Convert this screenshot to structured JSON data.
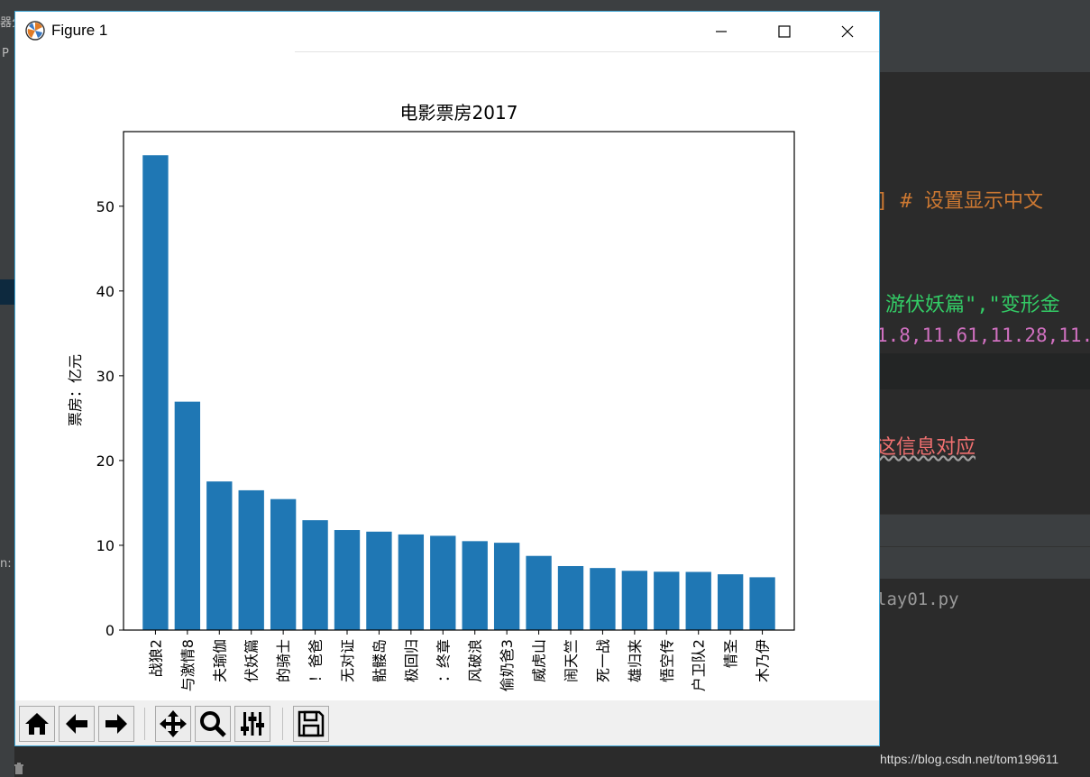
{
  "window": {
    "title": "Figure 1"
  },
  "background": {
    "top_left_text": "器分",
    "side_letter": "P",
    "side_colon": "n:",
    "code_lines": [
      "]  # 设置显示中文",
      "游伏妖篇\",\"变形金",
      "1.8,11.61,11.28,11.",
      "这信息对应",
      "lay01.py"
    ]
  },
  "watermark": "https://blog.csdn.net/tom199611",
  "toolbar": {
    "buttons": [
      "home-icon",
      "back-icon",
      "forward-icon",
      "pan-icon",
      "zoom-icon",
      "configure-subplots-icon",
      "save-icon"
    ]
  },
  "colors": {
    "bar": "#1f77b4",
    "window_border": "#3fa7d6",
    "toolbar_bg": "#f0f0f0"
  },
  "chart_data": {
    "type": "bar",
    "title": "电影票房2017",
    "xlabel": "",
    "ylabel": "票房：亿元",
    "ylim": [
      0,
      58.8
    ],
    "yticks": [
      0,
      10,
      20,
      30,
      40,
      50
    ],
    "grid": false,
    "legend": false,
    "categories": [
      "战狼2",
      "与激情8",
      "夫瑜伽",
      "伏妖篇",
      "的骑士",
      "！爸爸",
      "无对证",
      "骷髅岛",
      "极回归",
      "：终章",
      "风破浪",
      "偷奶爸3",
      "威虎山",
      "闹天竺",
      "死一战",
      "雄归来",
      "悟空传",
      "户卫队2",
      "情圣",
      "木乃伊"
    ],
    "values": [
      56.01,
      26.94,
      17.53,
      16.49,
      15.45,
      12.96,
      11.8,
      11.61,
      11.28,
      11.12,
      10.49,
      10.3,
      8.75,
      7.55,
      7.32,
      6.99,
      6.88,
      6.86,
      6.58,
      6.23
    ]
  }
}
